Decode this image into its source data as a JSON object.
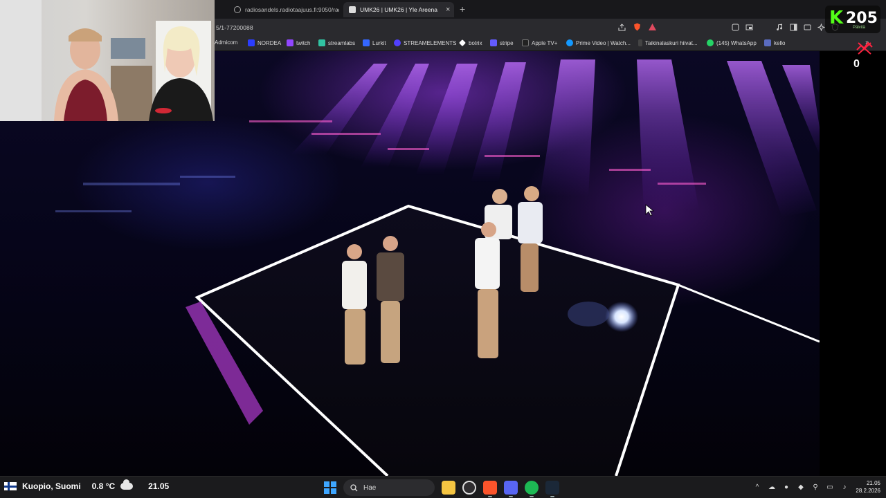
{
  "browser": {
    "tabs": [
      {
        "title": "radiosandels.radiotaajuus.fi:9050/rad",
        "active": false
      },
      {
        "title": "UMK26 | UMK26 | Yle Areena",
        "active": true
      }
    ],
    "new_tab_symbol": "+",
    "tab_close_symbol": "×",
    "url": "5/1-77200088",
    "bookmarks": [
      {
        "label": "Admicom",
        "icon": "admicom-icon",
        "color": "#2a2a2e"
      },
      {
        "label": "NORDEA",
        "icon": "nordea-icon",
        "color": "#2b3dff"
      },
      {
        "label": "twitch",
        "icon": "twitch-icon",
        "color": "#9146ff"
      },
      {
        "label": "streamlabs",
        "icon": "streamlabs-icon",
        "color": "#31c3a2"
      },
      {
        "label": "Lurkit",
        "icon": "lurkit-icon",
        "color": "#3466ff"
      },
      {
        "label": "STREAMELEMENTS",
        "icon": "streamelements-icon",
        "color": "#5140ff"
      },
      {
        "label": "botrix",
        "icon": "botrix-icon",
        "color": "#ffffff"
      },
      {
        "label": "stripe",
        "icon": "stripe-icon",
        "color": "#635bff"
      },
      {
        "label": "Apple TV+",
        "icon": "appletv-icon",
        "color": "#222222"
      },
      {
        "label": "Prime Video | Watch...",
        "icon": "primevideo-icon",
        "color": "#1399ff"
      },
      {
        "label": "Taikinalaskuri hiivat...",
        "icon": "taikina-icon",
        "color": "#444444"
      },
      {
        "label": "(145) WhatsApp",
        "icon": "whatsapp-icon",
        "color": "#25d366"
      },
      {
        "label": "kello",
        "icon": "kello-icon",
        "color": "#5a6bbf"
      }
    ]
  },
  "overlay": {
    "kick_logo": "K",
    "follower_count": "205",
    "kick_subtext": "Päivitä",
    "counter_zero": "0"
  },
  "taskbar": {
    "location": "Kuopio, Suomi",
    "temperature": "0.8 °C",
    "weather_time": "21.05",
    "search_placeholder": "Hae",
    "clock_time": "21.05",
    "clock_date": "28.2.2026",
    "apps": [
      "file-explorer-icon",
      "obs-icon",
      "brave-icon",
      "discord-icon",
      "spotify-icon",
      "steam-icon"
    ]
  },
  "colors": {
    "kick_green": "#53fc18",
    "stage_purple": "#9a3cff",
    "chrome_bg": "#2a2a2e",
    "taskbar_bg": "#1b1b1d"
  }
}
